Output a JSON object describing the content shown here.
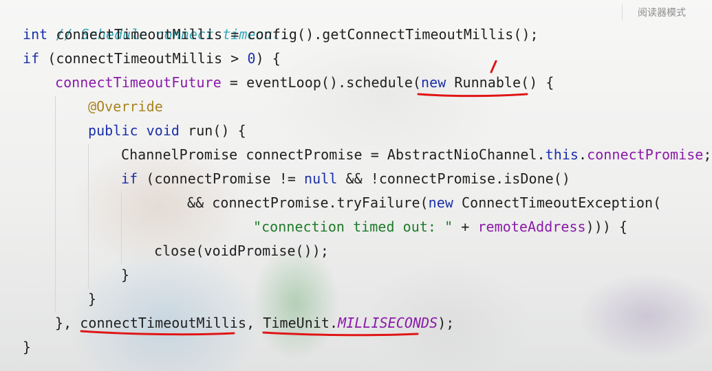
{
  "reader_mode_label": "阅读器模式",
  "code": {
    "line1": {
      "comment": "// Schedule connect timeout."
    },
    "line2": {
      "kw_int": "int",
      "rest": " connectTimeoutMillis = config().getConnectTimeoutMillis();"
    },
    "line3": {
      "kw_if": "if",
      "pre": " (connectTimeoutMillis > ",
      "zero": "0",
      "post": ") {"
    },
    "line4": {
      "field": "connectTimeoutFuture",
      "mid": " = eventLoop().schedule(",
      "kw_new": "new",
      "space": " ",
      "runnable": "Runnable",
      "post": "() {"
    },
    "line5": {
      "annotation": "@Override"
    },
    "line6": {
      "kw_public": "public",
      "sp1": " ",
      "kw_void": "void",
      "rest": " run() {"
    },
    "line7": {
      "pre": "ChannelPromise connectPromise = AbstractNioChannel.",
      "kw_this": "this",
      "dot": ".",
      "field": "connectPromise",
      "semi": ";"
    },
    "line8": {
      "kw_if": "if",
      "mid": " (connectPromise != ",
      "kw_null": "null",
      "rest": " && !connectPromise.isDone()"
    },
    "line9": {
      "pre": "&& connectPromise.tryFailure(",
      "kw_new": "new",
      "rest": " ConnectTimeoutException("
    },
    "line10": {
      "string": "\"connection timed out: \"",
      "plus": " + ",
      "field": "remoteAddress",
      "post": "))) {"
    },
    "line11": {
      "text": "close(voidPromise());"
    },
    "line12": {
      "text": "}"
    },
    "line13": {
      "text": "}"
    },
    "line14": {
      "pre": "}, ",
      "millis": "connectTimeoutMillis",
      "comma": ", ",
      "timeunit": "TimeUnit",
      "dot": ".",
      "milliseconds": "MILLISECONDS",
      "post": ");"
    },
    "line15": {
      "text": "}"
    }
  },
  "colors": {
    "keyword": "#1a2fa8",
    "field": "#8a1aa8",
    "comment": "#37a9b8",
    "annotation": "#a8841f",
    "string": "#1e7a28",
    "annotation_mark": "#e01515"
  }
}
